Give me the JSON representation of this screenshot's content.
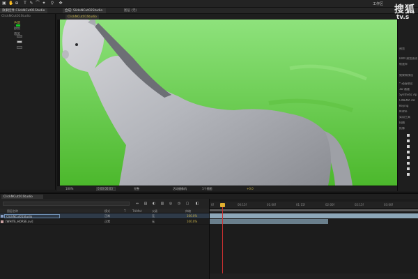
{
  "toolbar": {
    "tools": [
      "▣",
      "✋",
      "⊕",
      "T",
      "✎",
      "⌒",
      "✦",
      "⚲",
      "✥"
    ],
    "workspace_label": "工作区"
  },
  "panels": {
    "project_tab": "项目",
    "effects_tab": "效果控件 ClickNCut01Studio",
    "comp_tab_a": "合成: SlideNCut02Studio",
    "comp_tab_b": "图层 (无)"
  },
  "left_panel": {
    "title": "ClickNCut01Studio",
    "effect_row": "色键",
    "sub_row_1": "颜色",
    "sub_row_2": "容差"
  },
  "comp": {
    "active_tab": "ClickNCut01Studio"
  },
  "viewer_footer": {
    "zoom": "100%",
    "timecode": "0:00:00:03",
    "resolution": "完整",
    "camera": "活动摄像机",
    "views": "1个视图",
    "exposure": "+0.0"
  },
  "watermark": {
    "line1": "搜狐",
    "line2": "tv.s"
  },
  "right_panel": {
    "lines": [
      "预览",
      "RAM 预览选项",
      "帧速率",
      "效果和预设",
      "* 动画预设",
      "3D 通道",
      "Synthetic Ap",
      "CINEMA 4D",
      "Keying",
      "Matte",
      "实用工具",
      "扭曲",
      "抠像"
    ]
  },
  "timeline": {
    "tab": "ClickNCut01Studio",
    "headers": [
      "图层名称",
      "模式",
      "T",
      "TrkMat",
      "父级",
      "伸缩"
    ],
    "layers": [
      {
        "name": "ClickNCut01Studio",
        "mode": "正常",
        "parent": "无",
        "stretch": "100.0%",
        "color": "#8a9ec4"
      },
      {
        "name": "[WHITE_HORSE.avi]",
        "mode": "正常",
        "parent": "无",
        "stretch": "100.0%",
        "color": "#c9a0a0"
      }
    ],
    "ruler_ticks": [
      "0f",
      "00:15f",
      "01:00f",
      "01:15f",
      "02:00f",
      "02:15f",
      "03:00f"
    ],
    "colors": {
      "layer1_bar": "#8da7b8",
      "layer2_bar": "#6a7f8c",
      "cti": "#d03030"
    }
  }
}
